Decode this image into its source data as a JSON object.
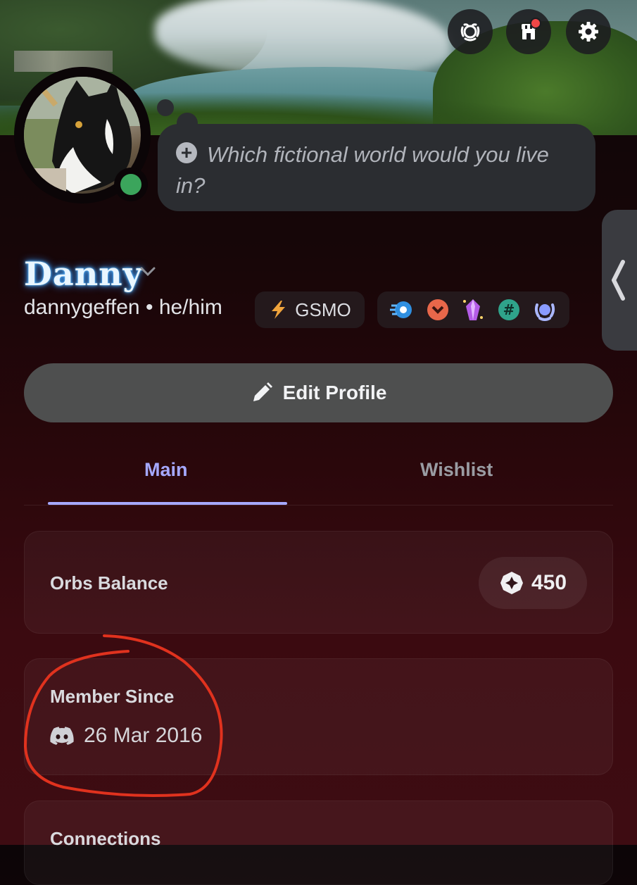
{
  "header": {
    "buttons": [
      {
        "name": "nitro-wreath-button",
        "icon": "laurel-icon"
      },
      {
        "name": "shop-button",
        "icon": "shop-icon",
        "has_notification": true
      },
      {
        "name": "settings-button",
        "icon": "gear-icon"
      }
    ]
  },
  "profile": {
    "status": "online",
    "thought_prompt": "Which fictional world would you live in?",
    "display_name": "Danny",
    "username": "dannygeffen",
    "pronouns": "he/him",
    "separator": "•",
    "server_tag": "GSMO",
    "badges": [
      "speed-badge-icon",
      "chevron-badge-icon",
      "crystal-badge-icon",
      "hashtag-badge-icon",
      "laurel-badge-icon"
    ]
  },
  "actions": {
    "edit_profile_label": "Edit Profile"
  },
  "tabs": [
    {
      "label": "Main",
      "active": true
    },
    {
      "label": "Wishlist",
      "active": false
    }
  ],
  "orbs": {
    "label": "Orbs Balance",
    "value": "450"
  },
  "member_since": {
    "label": "Member Since",
    "date": "26 Mar 2016"
  },
  "connections": {
    "label": "Connections"
  },
  "colors": {
    "accent": "#a5a8ff",
    "online": "#3ba55c",
    "annotation": "#e0321e"
  }
}
